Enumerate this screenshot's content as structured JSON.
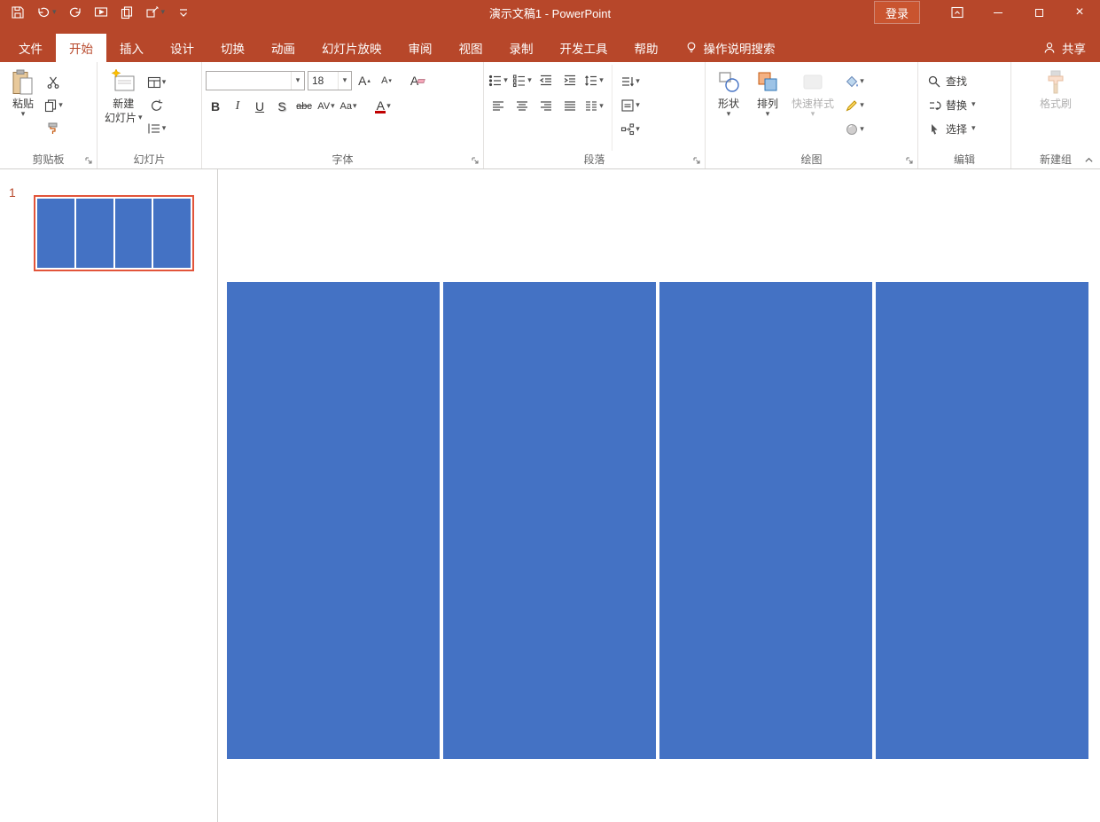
{
  "colors": {
    "titlebar": "#B7472A",
    "accent_blue": "#4472C4",
    "selection_border": "#E2543A"
  },
  "titlebar": {
    "title": "演示文稿1 - PowerPoint",
    "sign_in": "登录"
  },
  "tabs": {
    "items": [
      {
        "key": "file",
        "label": "文件"
      },
      {
        "key": "home",
        "label": "开始",
        "active": true
      },
      {
        "key": "insert",
        "label": "插入"
      },
      {
        "key": "design",
        "label": "设计"
      },
      {
        "key": "transitions",
        "label": "切换"
      },
      {
        "key": "animations",
        "label": "动画"
      },
      {
        "key": "slideshow",
        "label": "幻灯片放映"
      },
      {
        "key": "review",
        "label": "审阅"
      },
      {
        "key": "view",
        "label": "视图"
      },
      {
        "key": "record",
        "label": "录制"
      },
      {
        "key": "developer",
        "label": "开发工具"
      },
      {
        "key": "help",
        "label": "帮助"
      }
    ],
    "search": "操作说明搜索",
    "share": "共享"
  },
  "ribbon": {
    "clipboard": {
      "label": "剪贴板",
      "paste": "粘贴"
    },
    "slides": {
      "label": "幻灯片",
      "new_slide_1": "新建",
      "new_slide_2": "幻灯片"
    },
    "font": {
      "label": "字体",
      "font_name": "",
      "font_size": "18",
      "bold": "B",
      "italic": "I",
      "underline": "U",
      "shadow": "S",
      "strike": "abc",
      "spacing": "AV",
      "case": "Aa",
      "grow": "A",
      "shrink": "A",
      "clear": "A",
      "color": "A"
    },
    "paragraph": {
      "label": "段落"
    },
    "drawing": {
      "label": "绘图",
      "shapes": "形状",
      "arrange": "排列",
      "quick_styles": "快速样式"
    },
    "editing": {
      "label": "编辑",
      "find": "查找",
      "replace": "替换",
      "select": "选择"
    },
    "new_group": {
      "label": "新建组",
      "format_painter": "格式刷"
    }
  },
  "slides_panel": {
    "current_number": "1"
  },
  "slide": {
    "bar_count": 4
  }
}
